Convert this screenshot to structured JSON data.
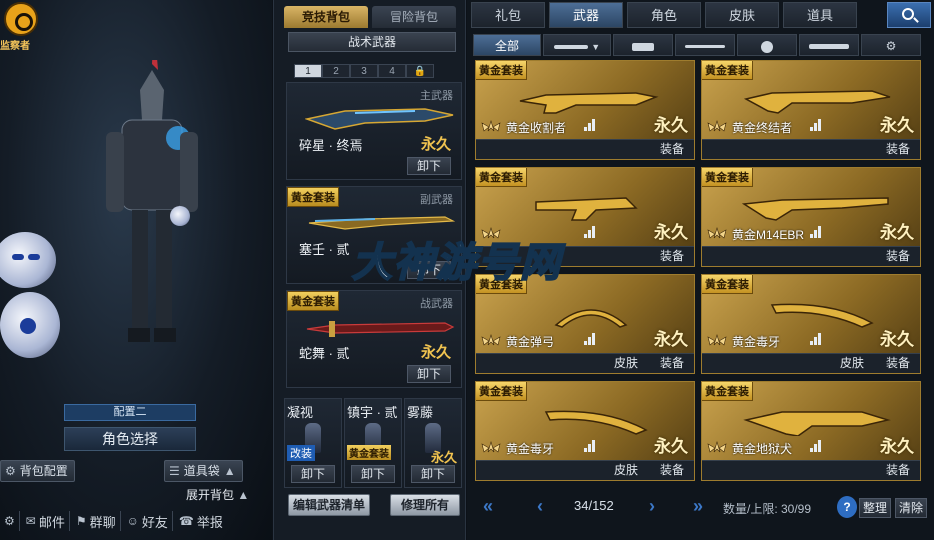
{
  "left": {
    "logo_label": "监察者",
    "config_tab": "配置二",
    "role_button": "角色选择",
    "bag_config": "背包配置",
    "item_bag": "道具袋",
    "expand_bag": "展开背包",
    "bottom_bar": [
      "邮件",
      "群聊",
      "好友",
      "举报"
    ]
  },
  "mid": {
    "bag_tabs": [
      "竞技背包",
      "冒险背包"
    ],
    "tactical_weapon": "战术武器",
    "slots": [
      "1",
      "2",
      "3",
      "4"
    ],
    "slots_locked": "🔒",
    "primary": {
      "category": "主武器",
      "name": "碎星 · 终焉",
      "perm": "永久",
      "unequip": "卸下"
    },
    "secondary": {
      "badge": "黄金套装",
      "category": "副武器",
      "name": "塞壬 · 贰",
      "unequip": "卸下"
    },
    "melee": {
      "badge": "黄金套装",
      "category": "战武器",
      "name": "蛇舞 · 贰",
      "perm": "永久",
      "unequip": "卸下"
    },
    "small": [
      {
        "title": "凝视",
        "tag": "改装",
        "btn": "卸下"
      },
      {
        "title": "镇宇 · 贰",
        "tag": "黄金套装",
        "btn": "卸下"
      },
      {
        "title": "雾藤",
        "perm": "永久",
        "btn": "卸下"
      }
    ],
    "edit_list": "编辑武器清单",
    "fix_all": "修理所有"
  },
  "right": {
    "main_tabs": [
      "礼包",
      "武器",
      "角色",
      "皮肤",
      "道具"
    ],
    "active_main_tab": "武器",
    "sub_tabs": {
      "all": "全部"
    },
    "items": [
      {
        "badge": "黄金套装",
        "name": "黄金收割者",
        "perm": "永久",
        "actions": [
          "装备"
        ]
      },
      {
        "badge": "黄金套装",
        "name": "黄金终结者",
        "perm": "永久",
        "actions": [
          "装备"
        ]
      },
      {
        "badge": "黄金套装",
        "name": "",
        "perm": "永久",
        "actions": [
          "装备"
        ]
      },
      {
        "badge": "黄金套装",
        "name": "黄金M14EBR",
        "perm": "永久",
        "actions": [
          "装备"
        ]
      },
      {
        "badge": "黄金套装",
        "name": "黄金弹弓",
        "perm": "永久",
        "actions": [
          "皮肤",
          "装备"
        ]
      },
      {
        "badge": "黄金套装",
        "name": "黄金毒牙",
        "perm": "永久",
        "actions": [
          "皮肤",
          "装备"
        ]
      },
      {
        "badge": "黄金套装",
        "name": "黄金毒牙",
        "perm": "永久",
        "actions": [
          "皮肤",
          "装备"
        ]
      },
      {
        "badge": "黄金套装",
        "name": "黄金地狱犬",
        "perm": "永久",
        "actions": [
          "装备"
        ]
      }
    ],
    "page": "34/152",
    "capacity": "数量/上限: 30/99",
    "help": "?",
    "sort": "整理",
    "clear": "清除"
  },
  "watermark": "大神游号网",
  "colors": {
    "gold": "#caa34e",
    "accent_blue": "#3c78c8",
    "panel": "#151c25"
  }
}
